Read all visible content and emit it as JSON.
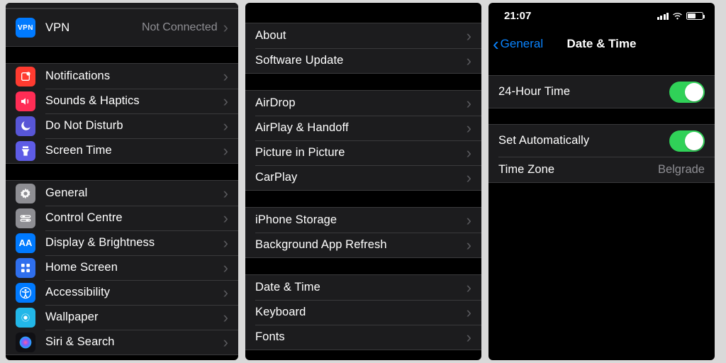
{
  "screen1": {
    "vpn": {
      "label": "VPN",
      "value": "Not Connected",
      "icon_text": "VPN"
    },
    "groups": [
      {
        "items": [
          {
            "key": "notifications",
            "label": "Notifications"
          },
          {
            "key": "sounds",
            "label": "Sounds & Haptics"
          },
          {
            "key": "dnd",
            "label": "Do Not Disturb"
          },
          {
            "key": "screentime",
            "label": "Screen Time"
          }
        ]
      },
      {
        "items": [
          {
            "key": "general",
            "label": "General"
          },
          {
            "key": "controlcentre",
            "label": "Control Centre"
          },
          {
            "key": "display",
            "label": "Display & Brightness",
            "icon_text": "AA"
          },
          {
            "key": "homescreen",
            "label": "Home Screen"
          },
          {
            "key": "accessibility",
            "label": "Accessibility"
          },
          {
            "key": "wallpaper",
            "label": "Wallpaper"
          },
          {
            "key": "siri",
            "label": "Siri & Search"
          }
        ]
      }
    ]
  },
  "screen2": {
    "groups": [
      {
        "items": [
          {
            "key": "about",
            "label": "About"
          },
          {
            "key": "softwareupdate",
            "label": "Software Update"
          }
        ]
      },
      {
        "items": [
          {
            "key": "airdrop",
            "label": "AirDrop"
          },
          {
            "key": "airplay",
            "label": "AirPlay & Handoff"
          },
          {
            "key": "pip",
            "label": "Picture in Picture"
          },
          {
            "key": "carplay",
            "label": "CarPlay"
          }
        ]
      },
      {
        "items": [
          {
            "key": "iphonestorage",
            "label": "iPhone Storage"
          },
          {
            "key": "bgrefresh",
            "label": "Background App Refresh"
          }
        ]
      },
      {
        "items": [
          {
            "key": "datetime",
            "label": "Date & Time"
          },
          {
            "key": "keyboard",
            "label": "Keyboard"
          },
          {
            "key": "fonts",
            "label": "Fonts"
          }
        ]
      }
    ]
  },
  "screen3": {
    "status": {
      "time": "21:07"
    },
    "nav": {
      "back": "General",
      "title": "Date & Time"
    },
    "rows": {
      "twentyfour": {
        "label": "24-Hour Time",
        "on": true
      },
      "setauto": {
        "label": "Set Automatically",
        "on": true
      },
      "timezone": {
        "label": "Time Zone",
        "value": "Belgrade"
      }
    }
  },
  "glyphs": {
    "chevron_right": "›",
    "chevron_left": "‹"
  }
}
